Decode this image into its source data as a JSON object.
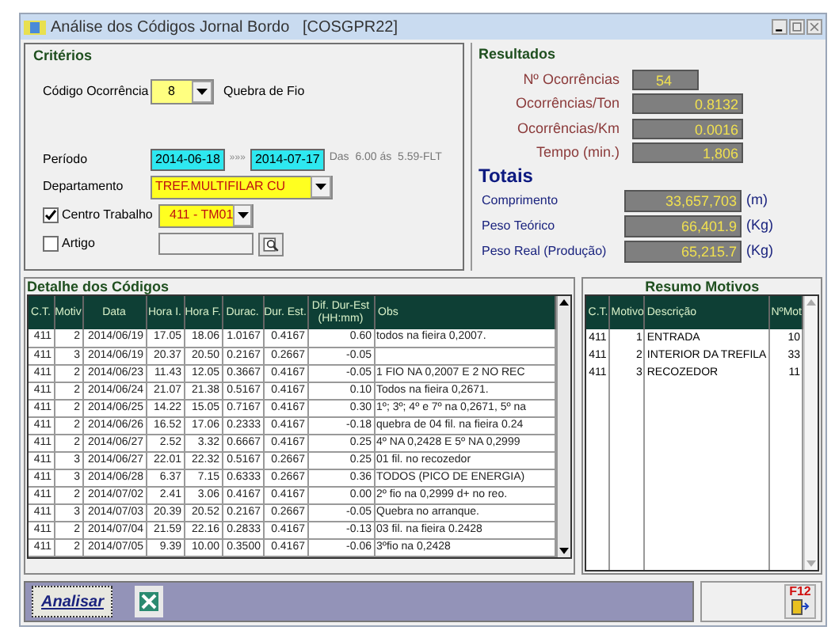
{
  "window": {
    "title": "Análise dos Códigos Jornal Bordo   [COSGPR22]"
  },
  "criteria": {
    "title": "Critérios",
    "code": {
      "label": "Código Ocorrência",
      "value": "8",
      "description": "Quebra de Fio"
    },
    "period": {
      "label": "Período",
      "from": "2014-06-18",
      "separator": "»»»",
      "to": "2014-07-17",
      "note": "Das  6.00 ás  5.59-FLT"
    },
    "department": {
      "label": "Departamento",
      "value": "TREF.MULTIFILAR CU"
    },
    "work_center": {
      "label": "Centro Trabalho",
      "checked": true,
      "value": "411 - TM01"
    },
    "article": {
      "label": "Artigo",
      "checked": false
    }
  },
  "results": {
    "title": "Resultados",
    "items": [
      {
        "label": "Nº Ocorrências",
        "value": "54"
      },
      {
        "label": "Ocorrências/Ton",
        "value": "0.8132"
      },
      {
        "label": "Ocorrências/Km",
        "value": "0.0016"
      },
      {
        "label": "Tempo (min.)",
        "value": "1,806"
      }
    ]
  },
  "totals": {
    "title": "Totais",
    "items": [
      {
        "label": "Comprimento",
        "value": "33,657,703",
        "unit": "(m)"
      },
      {
        "label": "Peso Teórico",
        "value": "66,401.9",
        "unit": "(Kg)"
      },
      {
        "label": "Peso Real (Produção)",
        "value": "65,215.7",
        "unit": "(Kg)"
      }
    ]
  },
  "details": {
    "title": "Detalhe dos Códigos",
    "columns": [
      "C.T.",
      "Motiv",
      "Data",
      "Hora I.",
      "Hora F.",
      "Durac.",
      "Dur. Est.",
      "Dif. Dur-Est (HH:mm)",
      "Obs"
    ],
    "rows": [
      [
        "411",
        "2",
        "2014/06/19",
        "17.05",
        "18.06",
        "1.0167",
        "0.4167",
        "0.60",
        "todos na fieira 0,2007."
      ],
      [
        "411",
        "3",
        "2014/06/19",
        "20.37",
        "20.50",
        "0.2167",
        "0.2667",
        "-0.05",
        ""
      ],
      [
        "411",
        "2",
        "2014/06/23",
        "11.43",
        "12.05",
        "0.3667",
        "0.4167",
        "-0.05",
        "1 FIO NA 0,2007 E 2 NO REC"
      ],
      [
        "411",
        "2",
        "2014/06/24",
        "21.07",
        "21.38",
        "0.5167",
        "0.4167",
        "0.10",
        "Todos na fieira 0,2671."
      ],
      [
        "411",
        "2",
        "2014/06/25",
        "14.22",
        "15.05",
        "0.7167",
        "0.4167",
        "0.30",
        "1º; 3º; 4º e 7º na 0,2671, 5º na"
      ],
      [
        "411",
        "2",
        "2014/06/26",
        "16.52",
        "17.06",
        "0.2333",
        "0.4167",
        "-0.18",
        "quebra de 04 fil. na fieira 0.24"
      ],
      [
        "411",
        "2",
        "2014/06/27",
        "2.52",
        "3.32",
        "0.6667",
        "0.4167",
        "0.25",
        "4º NA 0,2428 E 5º NA 0,2999"
      ],
      [
        "411",
        "3",
        "2014/06/27",
        "22.01",
        "22.32",
        "0.5167",
        "0.2667",
        "0.25",
        "01 fil. no recozedor"
      ],
      [
        "411",
        "3",
        "2014/06/28",
        "6.37",
        "7.15",
        "0.6333",
        "0.2667",
        "0.36",
        "TODOS (PICO DE ENERGIA)"
      ],
      [
        "411",
        "2",
        "2014/07/02",
        "2.41",
        "3.06",
        "0.4167",
        "0.4167",
        "0.00",
        "2º fio na 0,2999 d+ no reo."
      ],
      [
        "411",
        "3",
        "2014/07/03",
        "20.39",
        "20.52",
        "0.2167",
        "0.2667",
        "-0.05",
        "Quebra no arranque."
      ],
      [
        "411",
        "2",
        "2014/07/04",
        "21.59",
        "22.16",
        "0.2833",
        "0.4167",
        "-0.13",
        "03 fil. na fieira 0.2428"
      ],
      [
        "411",
        "2",
        "2014/07/05",
        "9.39",
        "10.00",
        "0.3500",
        "0.4167",
        "-0.06",
        "3ºfio na 0,2428"
      ]
    ]
  },
  "summary": {
    "title": "Resumo Motivos",
    "columns": [
      "C.T.",
      "Motivo",
      "Descrição",
      "NºMot"
    ],
    "rows": [
      [
        "411",
        "1",
        "ENTRADA",
        "10"
      ],
      [
        "411",
        "2",
        "INTERIOR DA TREFILA",
        "33"
      ],
      [
        "411",
        "3",
        "RECOZEDOR",
        "11"
      ]
    ]
  },
  "toolbar": {
    "analyze": "Analisar",
    "exit_key": "F12"
  }
}
